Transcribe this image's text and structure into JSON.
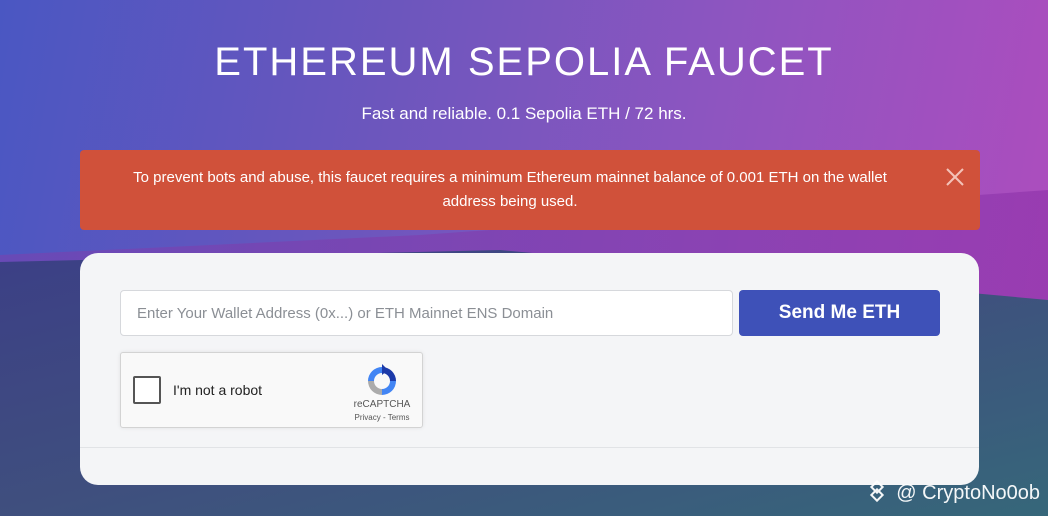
{
  "header": {
    "title": "ETHEREUM SEPOLIA FAUCET",
    "subtitle": "Fast and reliable. 0.1 Sepolia ETH / 72 hrs."
  },
  "alert": {
    "message": "To prevent bots and abuse, this faucet requires a minimum Ethereum mainnet balance of 0.001 ETH on the wallet address being used.",
    "close_icon": "close-icon",
    "color": "#d0513a"
  },
  "form": {
    "wallet_placeholder": "Enter Your Wallet Address (0x...) or ETH Mainnet ENS Domain",
    "wallet_value": "",
    "send_label": "Send Me ETH",
    "button_color": "#3e51b8"
  },
  "recaptcha": {
    "label": "I'm not a robot",
    "brand": "reCAPTCHA",
    "privacy": "Privacy",
    "separator": " - ",
    "terms": "Terms",
    "checked": false
  },
  "watermark": {
    "text": "@ CryptoNo0ob",
    "icon": "binance-square-icon"
  }
}
